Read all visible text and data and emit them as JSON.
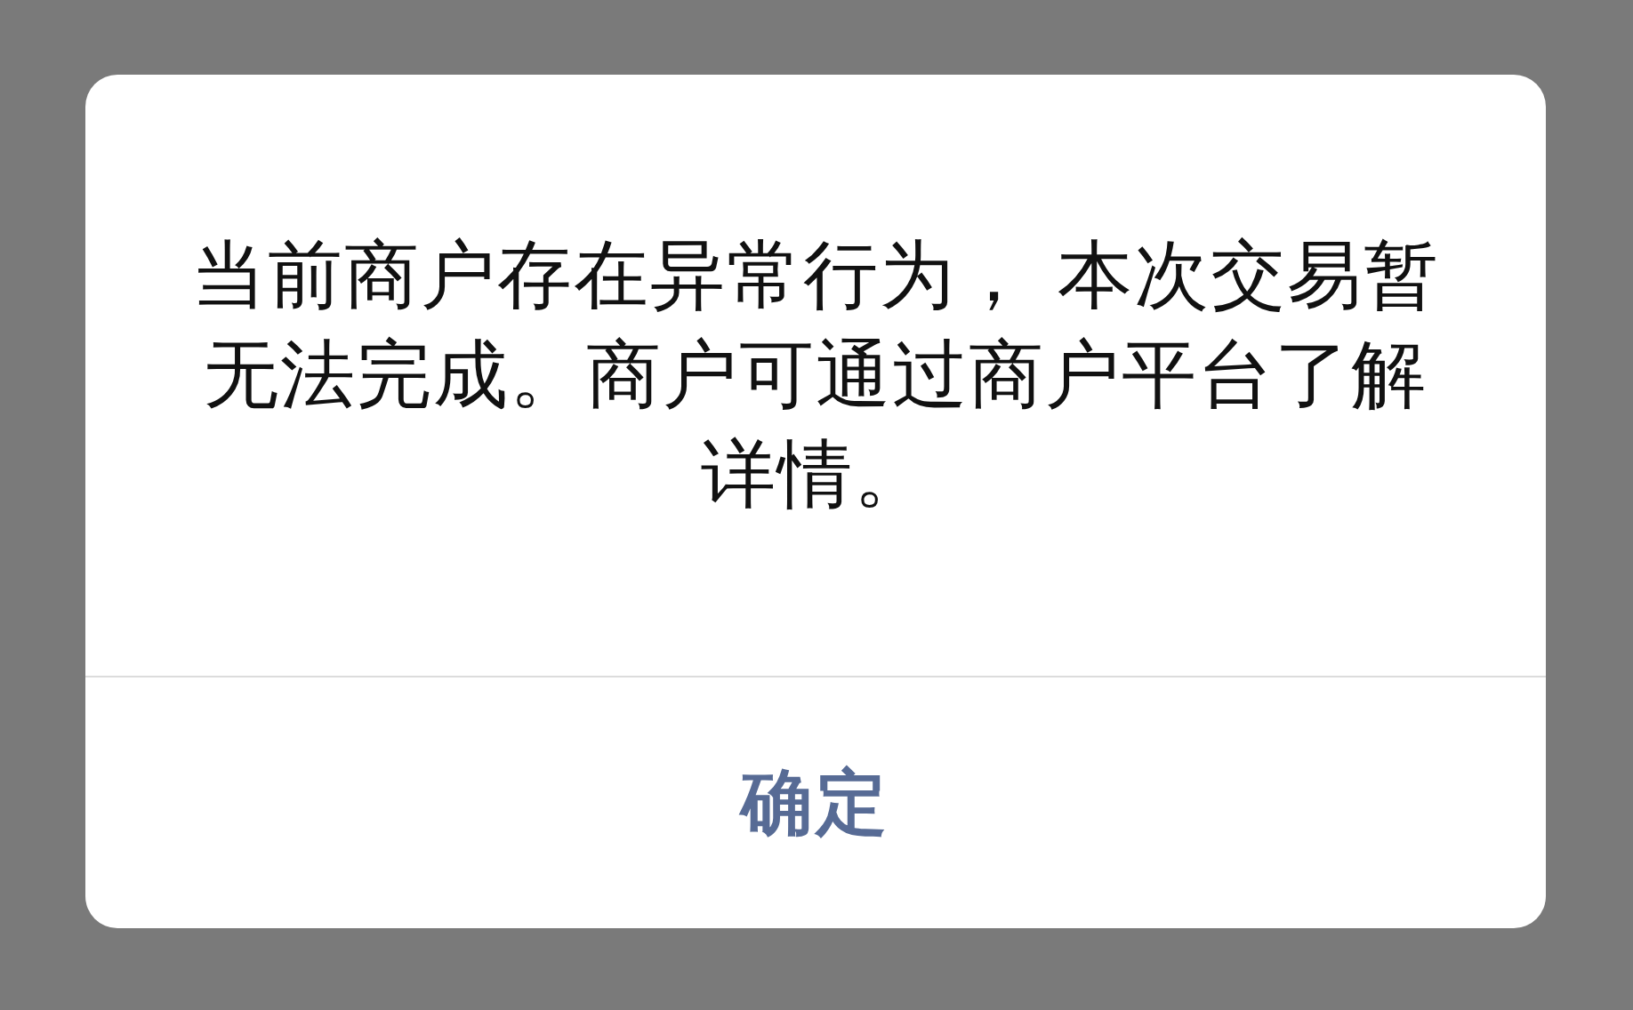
{
  "dialog": {
    "message": "当前商户存在异常行为， 本次交易暂无法完成。商户可通过商户平台了解详情。",
    "buttons": [
      {
        "label": "确定",
        "kind": "primary"
      }
    ]
  }
}
